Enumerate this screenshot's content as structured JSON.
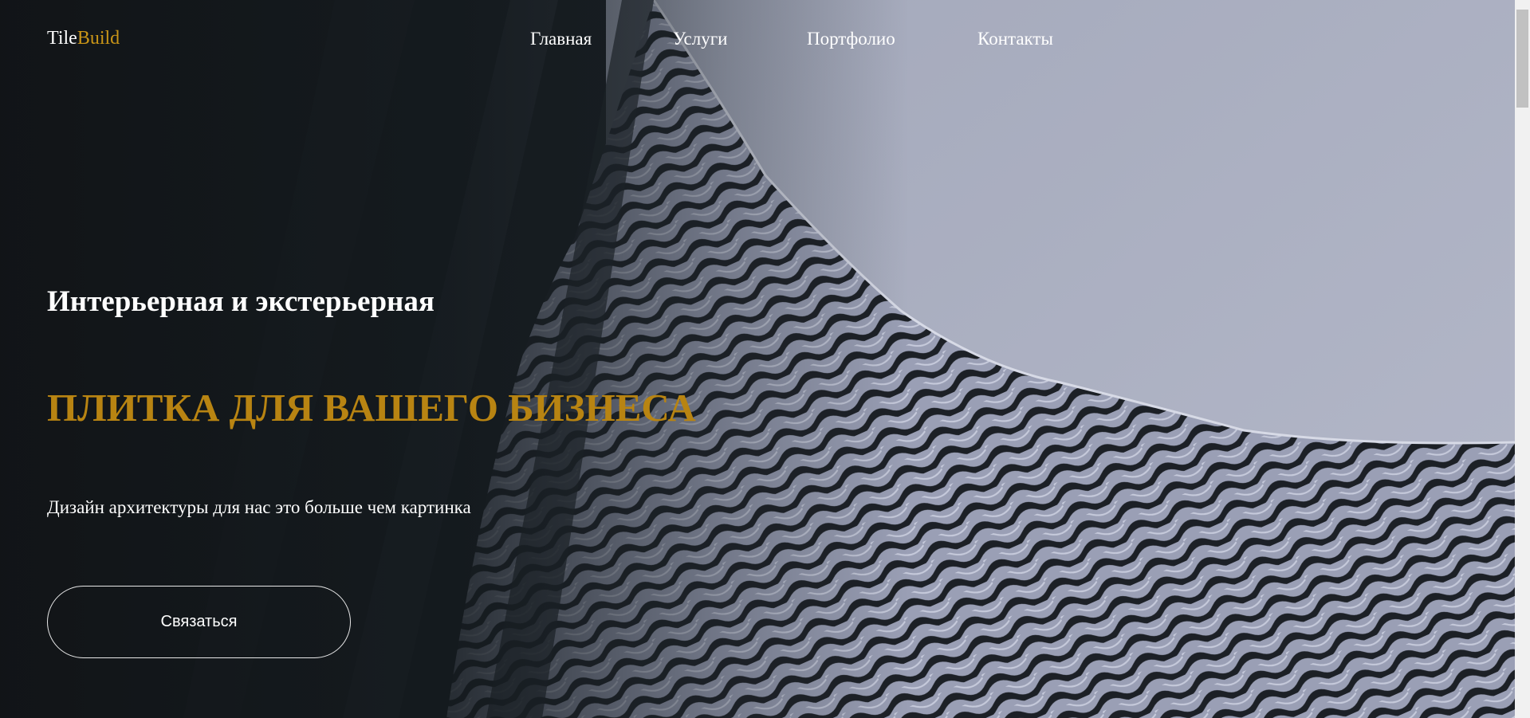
{
  "header": {
    "logo": {
      "part1": "Tile",
      "part2": "Build"
    },
    "nav": [
      {
        "label": "Главная"
      },
      {
        "label": "Услуги"
      },
      {
        "label": "Портфолио"
      },
      {
        "label": "Контакты"
      }
    ]
  },
  "hero": {
    "subtitle": "Интерьерная и экстерьерная",
    "title": "ПЛИТКА ДЛЯ ВАШЕГО БИЗНЕСА",
    "description": "Дизайн архитектуры для нас это больше чем картинка",
    "cta_label": "Связаться"
  },
  "colors": {
    "accent": "#c99517",
    "title_gold": "#b88412",
    "dark_bg": "#121619",
    "sky": "#a9aec2"
  }
}
